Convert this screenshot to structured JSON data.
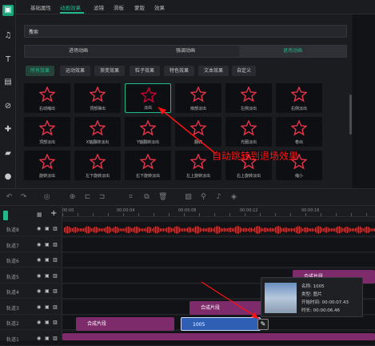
{
  "top_tabs": [
    "基础属性",
    "动画效果",
    "滤镜",
    "滑板",
    "蒙版",
    "效果"
  ],
  "active_tab": "动画效果",
  "search": {
    "placeholder": "搜索"
  },
  "segments": [
    "进场动画",
    "强调动画",
    "退场动画"
  ],
  "active_segment": "退场动画",
  "chips": [
    "所有效果",
    "运动效果",
    "渐变效果",
    "粒子效果",
    "特色效果",
    "文本效果",
    "自定义"
  ],
  "effects": [
    "右动缩出",
    "顶部弹出",
    "淡出",
    "扇部淡出",
    "左侧淡出",
    "右侧淡出",
    "顶部淡出",
    "X轴翻转淡出",
    "Y轴翻转淡出",
    "翻转",
    "光圈淡出",
    "卷出",
    "旋转淡出",
    "左下旋转淡出",
    "右下旋转淡出",
    "左上旋转淡出",
    "右上旋转淡出",
    "缩小"
  ],
  "annotation": "自动跳转到退场效果",
  "ruler": [
    "00:00",
    "00:00:04",
    "00:00:08",
    "00:00:12",
    "00:00:16"
  ],
  "tracks": [
    "轨道8",
    "轨道7",
    "轨道6",
    "轨道5",
    "轨道4",
    "轨道3",
    "轨道2",
    "轨道1"
  ],
  "clips": {
    "composite_label": "合成片段",
    "image_clip": "1005"
  },
  "tooltip": {
    "name": "名称: 1005",
    "type": "类型: 图片",
    "start": "开始时间: 00:00:07.43",
    "duration": "时长: 00:00:06.46"
  },
  "colors": {
    "accent": "#1fb98c",
    "clip_purple": "#7e2b6c",
    "clip_blue": "#2f5fb5",
    "annot_red": "#ff1111"
  }
}
